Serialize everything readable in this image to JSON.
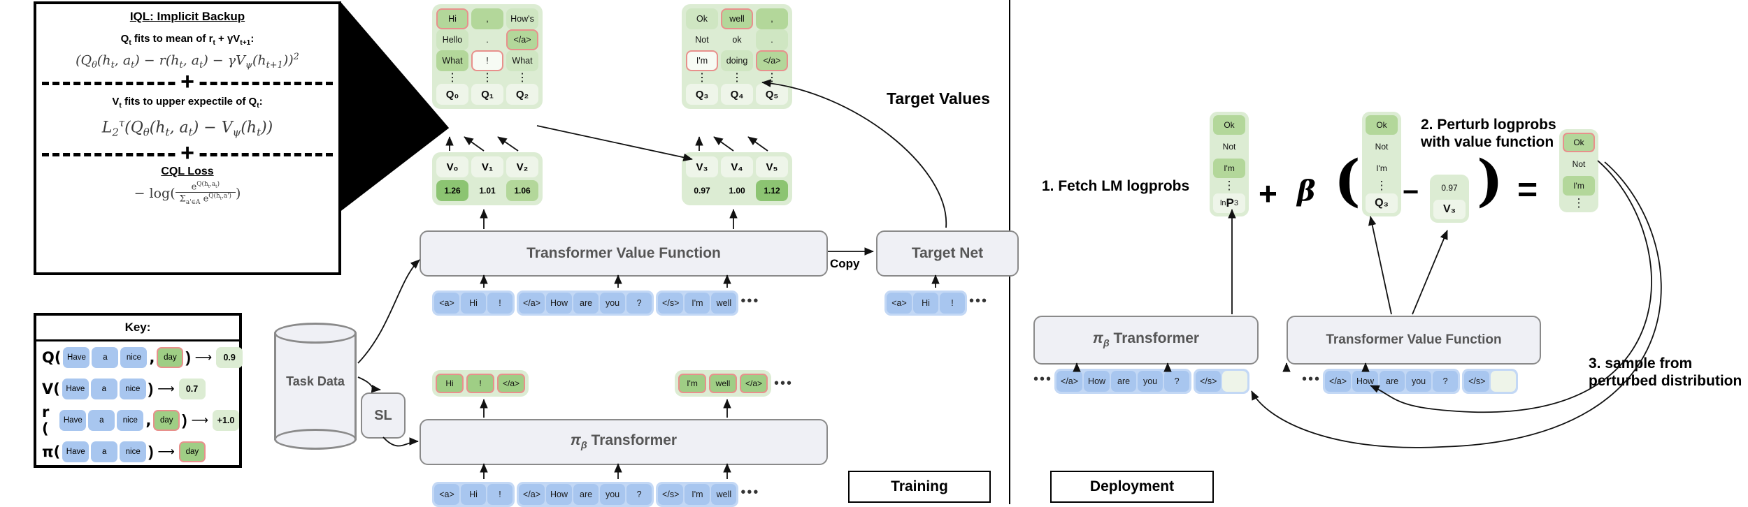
{
  "iql_panel": {
    "title": "IQL: Implicit Backup",
    "sub1_html": "Q<sub>t</sub> fits to mean of r<sub>t</sub> + &gamma;V<sub>t+1</sub>:",
    "eq1_html": "(Q<sub>&theta;</sub>(h<sub>t</sub>, a<sub>t</sub>) &minus; r(h<sub>t</sub>, a<sub>t</sub>) &minus; &gamma;V<sub>&psi;</sub>(h<sub>t+1</sub>))<sup>2</sup>",
    "plus": "+",
    "sub2_html": "V<sub>t</sub> fits to upper expectile of Q<sub>t</sub>:",
    "eq2_html": "L<sub>2</sub><sup>&tau;</sup>(Q<sub>&theta;</sub>(h<sub>t</sub>, a<sub>t</sub>) &minus; V<sub>&psi;</sub>(h<sub>t</sub>))",
    "cql_title": "CQL Loss",
    "cql_num": "e<sup>Q(h<sub>t</sub>,a<sub>t</sub>)</sup>",
    "cql_den": "&Sigma;<sub>a'&isin;A</sub> e<sup>Q(h<sub>t</sub>,a')</sup>",
    "cql_prefix": "&minus; log("
  },
  "key_panel": {
    "title": "Key:",
    "rows": [
      {
        "fn": "Q(",
        "tokens": [
          "Have",
          "a",
          "nice"
        ],
        "comma": ",",
        "action": "day",
        "close": ")",
        "arrow": "⟶",
        "value": "0.9"
      },
      {
        "fn": "V(",
        "tokens": [
          "Have",
          "a",
          "nice"
        ],
        "comma": "",
        "action": "",
        "close": ")",
        "arrow": "⟶",
        "value": "0.7"
      },
      {
        "fn": "r (",
        "tokens": [
          "Have",
          "a",
          "nice"
        ],
        "comma": ",",
        "action": "day",
        "close": ")",
        "arrow": "⟶",
        "value": "+1.0"
      },
      {
        "fn": "π(",
        "tokens": [
          "Have",
          "a",
          "nice"
        ],
        "comma": "",
        "action": "",
        "close": ")",
        "arrow": "⟶",
        "value": "day",
        "value_is_token": true
      }
    ]
  },
  "training": {
    "section_label": "Training",
    "task_data_label": "Task Data",
    "sl_label": "SL",
    "value_transformer_label": "Transformer Value Function",
    "policy_transformer_label": "πβ Transformer",
    "policy_transformer_pi": "π",
    "policy_transformer_beta": "β",
    "policy_transformer_word": "Transformer",
    "target_net_label": "Target Net",
    "copy_label": "Copy",
    "target_values_label": "Target Values",
    "q_block_1": {
      "rows": [
        [
          {
            "t": "Hi",
            "shade": "l1",
            "sel": true
          },
          {
            "t": ",",
            "shade": "l1",
            "sel": false
          },
          {
            "t": "How's",
            "shade": "l2",
            "sel": false
          }
        ],
        [
          {
            "t": "Hello",
            "shade": "l2",
            "sel": false
          },
          {
            "t": ".",
            "shade": "l0",
            "sel": false
          },
          {
            "t": "</a>",
            "shade": "l1",
            "sel": true
          }
        ],
        [
          {
            "t": "What",
            "shade": "l1",
            "sel": false
          },
          {
            "t": "!",
            "shade": "empty",
            "sel": true
          },
          {
            "t": "What",
            "shade": "l2",
            "sel": false
          }
        ]
      ],
      "dots": [
        "⋮",
        "⋮",
        "⋮"
      ],
      "labels": [
        "Q₀",
        "Q₁",
        "Q₂"
      ]
    },
    "q_block_2": {
      "rows": [
        [
          {
            "t": "Ok",
            "shade": "l2",
            "sel": false
          },
          {
            "t": "well",
            "shade": "l1",
            "sel": true
          },
          {
            "t": ",",
            "shade": "l1",
            "sel": false
          }
        ],
        [
          {
            "t": "Not",
            "shade": "l0",
            "sel": false
          },
          {
            "t": "ok",
            "shade": "l0",
            "sel": false
          },
          {
            "t": ".",
            "shade": "l2",
            "sel": false
          }
        ],
        [
          {
            "t": "I'm",
            "shade": "empty",
            "sel": true
          },
          {
            "t": "doing",
            "shade": "l2",
            "sel": false
          },
          {
            "t": "</a>",
            "shade": "l1",
            "sel": true
          }
        ]
      ],
      "dots": [
        "⋮",
        "⋮",
        "⋮"
      ],
      "labels": [
        "Q₃",
        "Q₄",
        "Q₅"
      ]
    },
    "v_block_1": {
      "labels": [
        "V₀",
        "V₁",
        "V₂"
      ],
      "values": [
        "1.26",
        "1.01",
        "1.06"
      ],
      "shades": [
        "hi",
        "none",
        "mid"
      ]
    },
    "v_block_2": {
      "labels": [
        "V₃",
        "V₄",
        "V₅"
      ],
      "values": [
        "0.97",
        "1.00",
        "1.12"
      ],
      "shades": [
        "none",
        "none",
        "hi"
      ]
    },
    "tokens_value_fn": [
      {
        "group": [
          "<a>",
          "Hi",
          "!"
        ]
      },
      {
        "group": [
          "</a>",
          "How",
          "are",
          "you",
          "?"
        ]
      },
      {
        "group": [
          "</s>",
          "I'm",
          "well"
        ]
      }
    ],
    "tokens_value_fn_ellipsis": "•••",
    "tokens_target_net": [
      {
        "group": [
          "<a>",
          "Hi",
          "!"
        ]
      }
    ],
    "tokens_target_net_ellipsis": "•••",
    "tokens_policy": [
      {
        "group": [
          "<a>",
          "Hi",
          "!"
        ]
      },
      {
        "group": [
          "</a>",
          "How",
          "are",
          "you",
          "?"
        ]
      },
      {
        "group": [
          "</s>",
          "I'm",
          "well"
        ]
      }
    ],
    "tokens_policy_ellipsis": "•••",
    "policy_out_1": [
      "Hi",
      "!",
      "</a>"
    ],
    "policy_out_2": [
      "I'm",
      "well",
      "</a>"
    ],
    "policy_out_ellipsis": "•••"
  },
  "deployment": {
    "section_label": "Deployment",
    "step1": "1. Fetch LM logprobs",
    "step2_line1": "2. Perturb logprobs",
    "step2_line2": "with value function",
    "step3_line1": "3. sample from",
    "step3_line2": "perturbed distribution",
    "plus": "+",
    "beta": "β",
    "paren_open": "(",
    "paren_close": ")",
    "minus": "−",
    "equals": "=",
    "logprob_col": {
      "cells": [
        {
          "t": "Ok",
          "shade": "mid",
          "sel": false
        },
        {
          "t": "Not",
          "shade": "none",
          "sel": false
        },
        {
          "t": "I'm",
          "shade": "mid",
          "sel": false
        }
      ],
      "dots": "⋮",
      "label_prefix": "ln ",
      "label_main": "P",
      "label_sub": "3"
    },
    "q_col": {
      "cells": [
        {
          "t": "Ok",
          "shade": "mid",
          "sel": false
        },
        {
          "t": "Not",
          "shade": "none",
          "sel": false
        },
        {
          "t": "I'm",
          "shade": "none",
          "sel": false
        }
      ],
      "dots": "⋮",
      "label": "Q₃"
    },
    "v_col": {
      "value": "0.97",
      "label": "V₃"
    },
    "result_col": {
      "cells": [
        {
          "t": "Ok",
          "shade": "mid",
          "sel": true
        },
        {
          "t": "Not",
          "shade": "none",
          "sel": false
        },
        {
          "t": "I'm",
          "shade": "mid",
          "sel": false
        }
      ],
      "dots": "⋮"
    },
    "policy_transformer_pi": "π",
    "policy_transformer_beta": "β",
    "policy_transformer_word": "Transformer",
    "value_transformer_label": "Transformer Value Function",
    "tokens_policy_lead": "•••",
    "tokens_policy": [
      {
        "group": [
          "</a>",
          "How",
          "are",
          "you",
          "?"
        ]
      },
      {
        "group": [
          "</s>",
          ""
        ]
      }
    ],
    "tokens_value_lead": "•••",
    "tokens_value": [
      {
        "group": [
          "</a>",
          "How",
          "are",
          "you",
          "?"
        ]
      },
      {
        "group": [
          "</s>",
          ""
        ]
      }
    ]
  },
  "colors": {
    "token_blue": "#a8c6ef",
    "token_blue_bg": "#c3d8f5",
    "green_light": "#dcecd3",
    "green_mid": "#b3d79a",
    "green_dark": "#8cc472",
    "select_red": "#e8908c",
    "module_gray": "#eff0f5",
    "module_border": "#8a8a8a"
  }
}
